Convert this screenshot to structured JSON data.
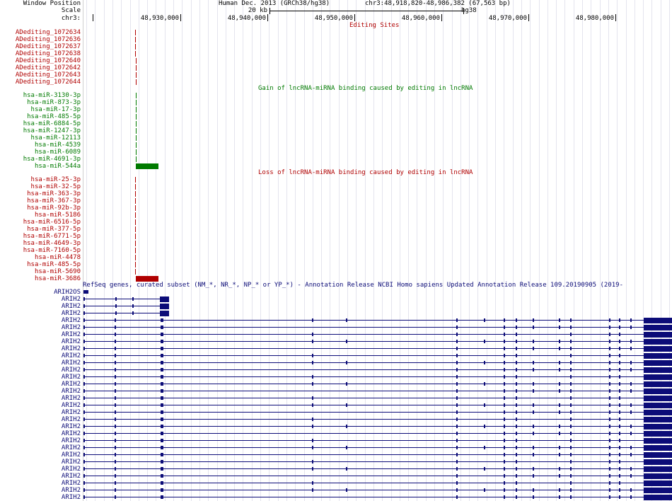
{
  "header": {
    "window_position_label": "Window Position",
    "scale_label": "Scale",
    "chrom_label": "chr3:",
    "assembly": "Human Dec. 2013 (GRCh38/hg38)",
    "position": "chr3:48,918,820-48,986,382 (67,563 bp)",
    "scale_text": "20 kb",
    "scale_db": "hg38",
    "ticks": [
      "48,930,000",
      "48,940,000",
      "48,950,000",
      "48,960,000",
      "48,970,000",
      "48,980,000"
    ]
  },
  "editing_sites": {
    "title": "Editing Sites",
    "color": "#b00000",
    "items": [
      "ADediting_1072634",
      "ADediting_1072636",
      "ADediting_1072637",
      "ADediting_1072638",
      "ADediting_1072640",
      "ADediting_1072642",
      "ADediting_1072643",
      "ADediting_1072644"
    ]
  },
  "gain": {
    "title": "Gain of lncRNA-miRNA binding caused by editing in lncRNA",
    "color": "#007a00",
    "items": [
      "hsa-miR-3130-3p",
      "hsa-miR-873-3p",
      "hsa-miR-17-3p",
      "hsa-miR-485-5p",
      "hsa-miR-6884-5p",
      "hsa-miR-1247-3p",
      "hsa-miR-12113",
      "hsa-miR-4539",
      "hsa-miR-6089",
      "hsa-miR-4691-3p",
      "hsa-miR-544a"
    ]
  },
  "loss": {
    "title": "Loss of lncRNA-miRNA binding caused by editing in lncRNA",
    "color": "#b00000",
    "items": [
      "hsa-miR-25-3p",
      "hsa-miR-32-5p",
      "hsa-miR-363-3p",
      "hsa-miR-367-3p",
      "hsa-miR-92b-3p",
      "hsa-miR-5186",
      "hsa-miR-6516-5p",
      "hsa-miR-377-5p",
      "hsa-miR-6771-5p",
      "hsa-miR-4649-3p",
      "hsa-miR-7160-5p",
      "hsa-miR-4478",
      "hsa-miR-485-5p",
      "hsa-miR-5690",
      "hsa-miR-3686"
    ]
  },
  "refseq": {
    "title": "RefSeq genes, curated subset (NM_*, NR_*, NP_* or YP_*) - Annotation Release NCBI Homo sapiens Updated Annotation Release 109.20190905 (2019-",
    "color": "#0c0c78",
    "items": [
      "ARIH2OS",
      "ARIH2",
      "ARIH2",
      "ARIH2",
      "ARIH2",
      "ARIH2",
      "ARIH2",
      "ARIH2",
      "ARIH2",
      "ARIH2",
      "ARIH2",
      "ARIH2",
      "ARIH2",
      "ARIH2",
      "ARIH2",
      "ARIH2",
      "ARIH2",
      "ARIH2",
      "ARIH2",
      "ARIH2",
      "ARIH2",
      "ARIH2",
      "ARIH2",
      "ARIH2",
      "ARIH2",
      "ARIH2",
      "ARIH2",
      "ARIH2",
      "ARIH2",
      "ARIH2"
    ]
  }
}
